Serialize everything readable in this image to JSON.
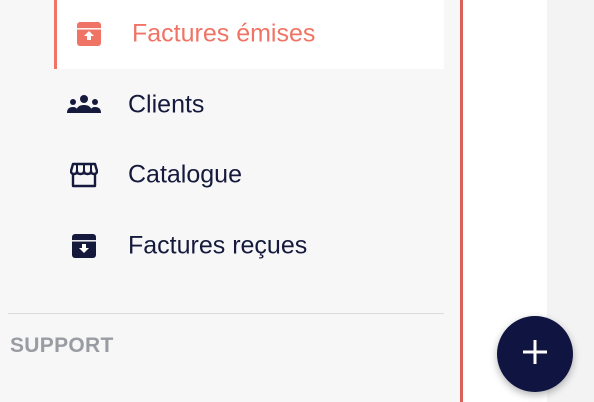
{
  "nav": {
    "items": [
      {
        "label": "Factures émises",
        "icon": "invoice-sent-icon",
        "active": true
      },
      {
        "label": "Clients",
        "icon": "people-group-icon",
        "active": false
      },
      {
        "label": "Catalogue",
        "icon": "store-icon",
        "active": false
      },
      {
        "label": "Factures reçues",
        "icon": "invoice-received-icon",
        "active": false
      }
    ]
  },
  "support": {
    "section_title": "SUPPORT"
  },
  "fab": {
    "icon": "plus-icon"
  },
  "colors": {
    "accent": "#f07465",
    "navy": "#151a3c",
    "fab": "#0f1440",
    "sidebar_border": "#d9615a",
    "muted": "#9a9ca3"
  }
}
